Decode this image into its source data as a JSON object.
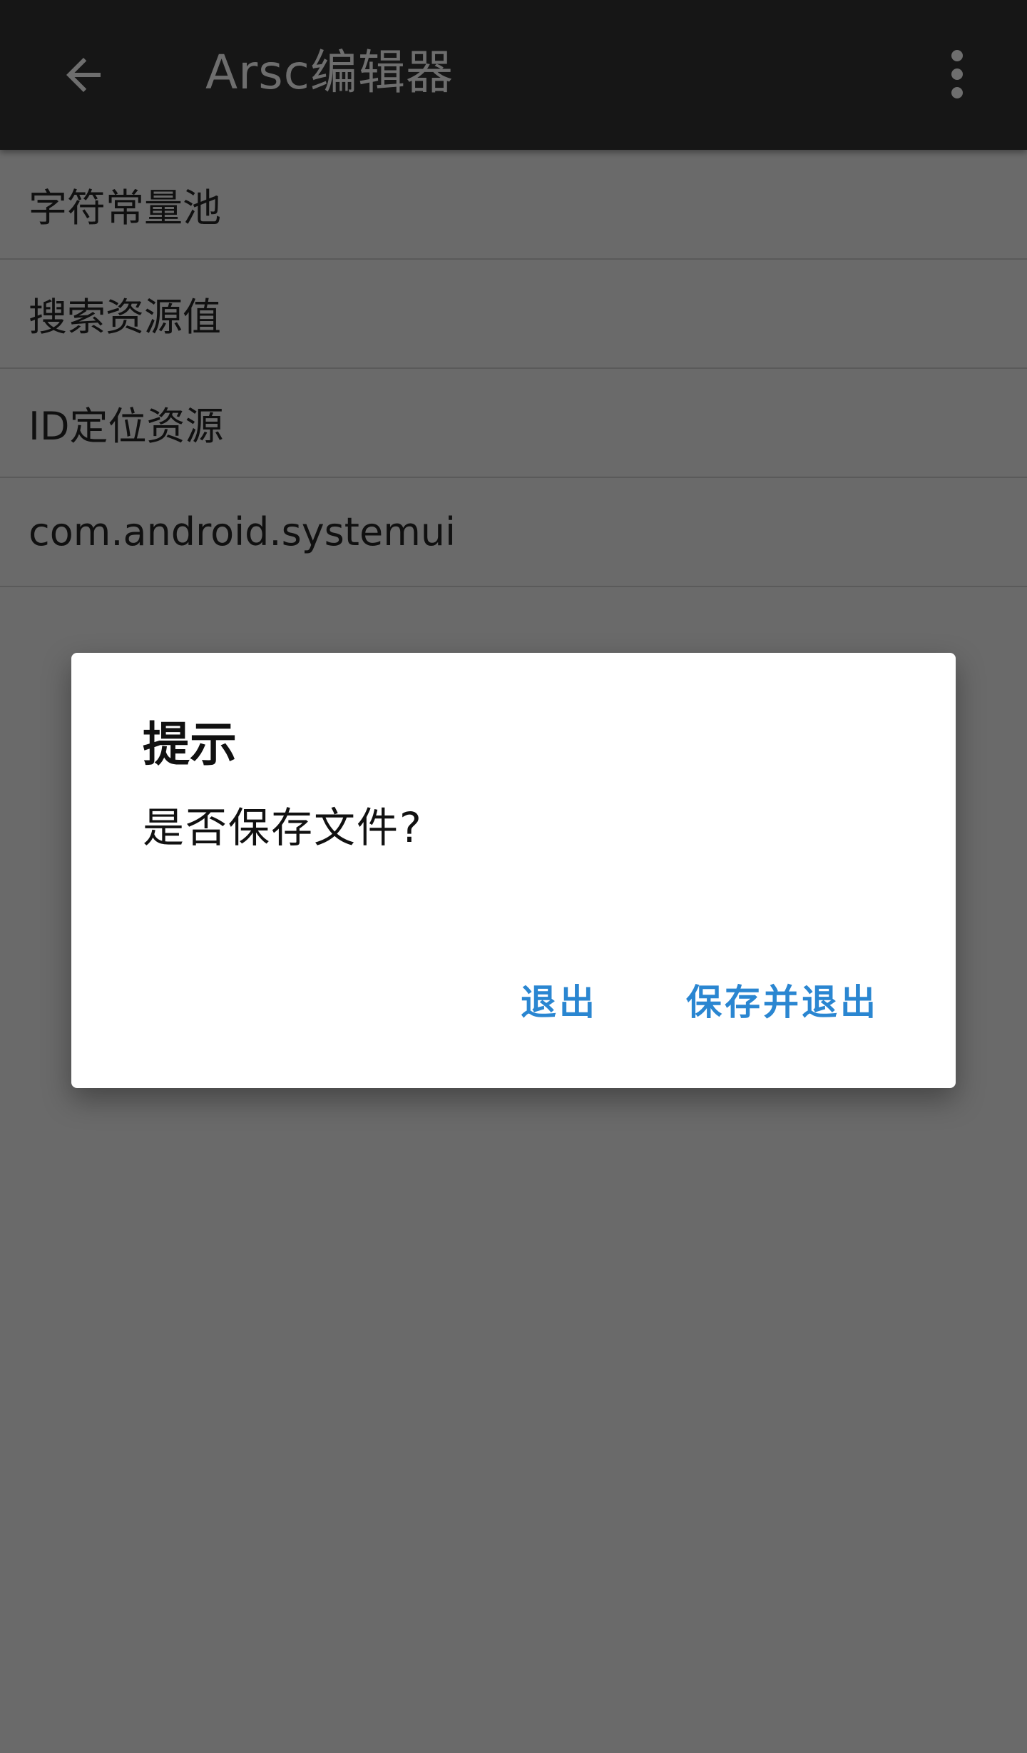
{
  "appbar": {
    "back_icon": "arrow-back-icon",
    "title": "Arsc编辑器",
    "overflow_icon": "more-vert-icon",
    "text_color": "#6e6e6e",
    "background": "#161616"
  },
  "list": {
    "items": [
      {
        "label": "字符常量池"
      },
      {
        "label": "搜索资源值"
      },
      {
        "label": "ID定位资源"
      },
      {
        "label": "com.android.systemui"
      }
    ]
  },
  "dialog": {
    "title": "提示",
    "message": "是否保存文件?",
    "buttons": {
      "exit": "退出",
      "save_and_exit": "保存并退出"
    },
    "accent_color": "#2a86d1"
  }
}
